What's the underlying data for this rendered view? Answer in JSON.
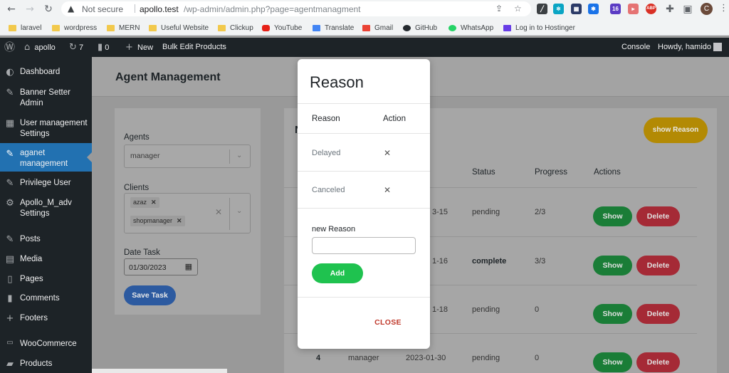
{
  "browser": {
    "security": "Not secure",
    "url_host": "apollo.test",
    "url_path": "/wp-admin/admin.php?page=agentmanagment",
    "avatar_letter": "C",
    "ext_badge": "16",
    "ext_abp": "ABP"
  },
  "bookmarks": [
    "laravel",
    "wordpress",
    "MERN",
    "Useful Website",
    "Clickup",
    "YouTube",
    "Translate",
    "Gmail",
    "GitHub",
    "WhatsApp",
    "Log in to Hostinger"
  ],
  "adminbar": {
    "site": "apollo",
    "updates": "7",
    "comments": "0",
    "new": "New",
    "bulk": "Bulk Edit Products",
    "console": "Console",
    "howdy": "Howdy, hamido"
  },
  "sidebar": {
    "items": [
      {
        "label": "Dashboard",
        "icon": "dashboard-icon"
      },
      {
        "label": "Banner Setter Admin",
        "icon": "pin-icon"
      },
      {
        "label": "User management Settings",
        "icon": "table-icon"
      },
      {
        "label": "aganet management",
        "icon": "pin-icon"
      },
      {
        "label": "Privilege User",
        "icon": "pin-icon"
      },
      {
        "label": "Apollo_M_adv Settings",
        "icon": "gear-icon"
      },
      {
        "label": "Posts",
        "icon": "pin-icon"
      },
      {
        "label": "Media",
        "icon": "media-icon"
      },
      {
        "label": "Pages",
        "icon": "pages-icon"
      },
      {
        "label": "Comments",
        "icon": "comment-icon"
      },
      {
        "label": "Footers",
        "icon": "plus-icon"
      },
      {
        "label": "WooCommerce",
        "icon": "woo-icon"
      },
      {
        "label": "Products",
        "icon": "product-icon"
      }
    ]
  },
  "page": {
    "title": "Agent Management"
  },
  "form": {
    "agents_label": "Agents",
    "agents_value": "manager",
    "clients_label": "Clients",
    "clients_chips": [
      "azaz",
      "shopmanager"
    ],
    "date_label": "Date Task",
    "date_value": "01/30/2023",
    "save_button": "Save Task"
  },
  "list": {
    "heading_letter": "N",
    "show_reason_button": "show Reason",
    "headers": {
      "status": "Status",
      "progress": "Progress",
      "actions": "Actions"
    },
    "rows": [
      {
        "date_frag": "3-15",
        "status": "pending",
        "progress": "2/3",
        "show": "Show",
        "delete": "Delete"
      },
      {
        "date_frag": "1-16",
        "status": "complete",
        "progress": "3/3",
        "show": "Show",
        "delete": "Delete"
      },
      {
        "date_frag": "1-18",
        "status": "pending",
        "progress": "0",
        "show": "Show",
        "delete": "Delete"
      },
      {
        "num": "4",
        "agent": "manager",
        "date": "2023-01-30",
        "status": "pending",
        "progress": "0",
        "show": "Show",
        "delete": "Delete"
      }
    ]
  },
  "modal": {
    "title": "Reason",
    "col_reason": "Reason",
    "col_action": "Action",
    "reasons": [
      "Delayed",
      "Canceled"
    ],
    "new_reason_label": "new Reason",
    "new_reason_value": "",
    "add_button": "Add",
    "close_button": "CLOSE"
  }
}
